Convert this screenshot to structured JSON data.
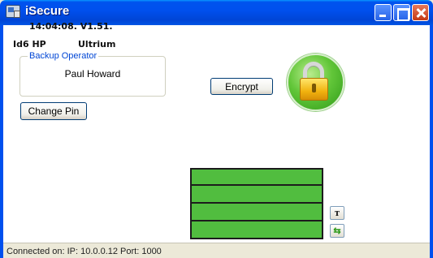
{
  "window": {
    "title": "iSecure"
  },
  "operator_group": {
    "legend": "Backup Operator",
    "name": "Paul Howard"
  },
  "buttons": {
    "change_pin": "Change Pin",
    "encrypt": "Encrypt",
    "eject_glyph": "т",
    "refresh_glyph": "⇆"
  },
  "lock": {
    "icon": "padlock-locked-icon",
    "circle_color": "#62c639"
  },
  "drive_panel": {
    "row1": "",
    "time_version": "14:04:08. V1.51.",
    "drive_id": "Id6 HP",
    "drive_model": "Ultrium",
    "row4": "",
    "background_color": "#51bd3f"
  },
  "status_bar": {
    "text": "Connected on:  IP: 10.0.0.12  Port: 1000"
  }
}
